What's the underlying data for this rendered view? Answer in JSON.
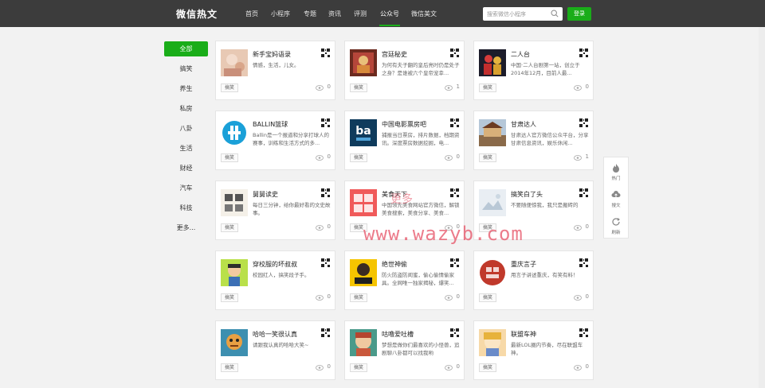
{
  "header": {
    "logo": "微信热文",
    "nav": [
      "首页",
      "小程序",
      "专题",
      "资讯",
      "评测",
      "公众号",
      "微信美文"
    ],
    "active_nav": "公众号",
    "search_placeholder": "搜索微信小程序",
    "login_label": "登录"
  },
  "sidebar": {
    "items": [
      "全部",
      "搞笑",
      "养生",
      "私房",
      "八卦",
      "生活",
      "财经",
      "汽车",
      "科技",
      "更多..."
    ],
    "active": "全部"
  },
  "cards": [
    {
      "title": "新手宝妈语录",
      "desc": "情感，生活，儿女。",
      "tag": "搞笑",
      "views": "0"
    },
    {
      "title": "宫廷秘史",
      "desc": "为何有夫子翻的皇后亮时仍是处子之身？是谁被六个皇帝宠幸...",
      "tag": "搞笑",
      "views": "1"
    },
    {
      "title": "二人台",
      "desc": "中国·二人台剧第一站，创立于2014年12月，目前人最...",
      "tag": "搞笑",
      "views": "0"
    },
    {
      "title": "BALLIN篮球",
      "desc": "Ballin是一个报道和分享打球人的赛事，训练和生活方式的多...",
      "tag": "搞笑",
      "views": "0"
    },
    {
      "title": "中国电影票房吧",
      "desc": "捕报当日票房，排片数据，档期资讯。深度票房数据挖掘，电...",
      "tag": "搞笑",
      "views": "0"
    },
    {
      "title": "甘肃达人",
      "desc": "甘肃达人官方微信公众平台，分享甘肃信息资讯，娱乐休闲...",
      "tag": "搞笑",
      "views": "1"
    },
    {
      "title": "舅舅读史",
      "desc": "每日三分钟，给你最好看的文史故事。",
      "tag": "搞笑",
      "views": "0"
    },
    {
      "title": "美食天下",
      "desc": "中国领先美食网站官方微信，解锁美食搜索，美食分享、美食...",
      "tag": "搞笑",
      "views": "0"
    },
    {
      "title": "搞笑白了头",
      "desc": "不要随便惊我，我只是搬砖的",
      "tag": "搞笑",
      "views": "0"
    },
    {
      "title": "穿校服的坏叔叔",
      "desc": "校园红人，搞笑段子手。",
      "tag": "搞笑",
      "views": "0"
    },
    {
      "title": "绝世神偷",
      "desc": "防火防盗防闺蜜，偷心偷情偷家具。全网唯一独家揭秘，爆笑...",
      "tag": "搞笑",
      "views": "0"
    },
    {
      "title": "重庆言子",
      "desc": "用言子讲述重庆，有笑有料！",
      "tag": "搞笑",
      "views": "0"
    },
    {
      "title": "哈哈一笑很认真",
      "desc": "请跟我认真的哈哈大笑~",
      "tag": "搞笑",
      "views": "0"
    },
    {
      "title": "咕噜爱吐槽",
      "desc": "梦想是做你们最喜欢的小怪兽，追剧聊八卦都可以找我哟",
      "tag": "搞笑",
      "views": "0"
    },
    {
      "title": "联盟车神",
      "desc": "最新LOL圈内节奏，尽在联盟车神。",
      "tag": "搞笑",
      "views": "0"
    }
  ],
  "float_panel": [
    "热门",
    "搜文",
    "刷新"
  ],
  "watermark": "www.wazyb.com",
  "watermark_small": "更多",
  "colors": {
    "accent": "#1aad19",
    "header": "#3c3c3c",
    "watermark": "#e65064"
  }
}
